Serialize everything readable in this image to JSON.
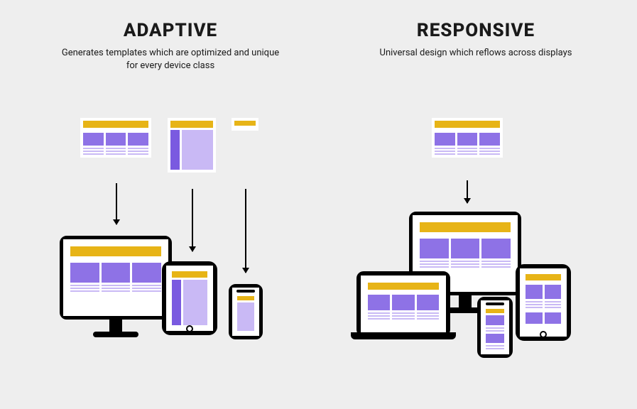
{
  "adaptive": {
    "title": "ADAPTIVE",
    "subtitle": "Generates templates which are optimized and unique for every device class"
  },
  "responsive": {
    "title": "RESPONSIVE",
    "subtitle": "Universal design which reflows across displays"
  },
  "colors": {
    "accent": "#e7b417",
    "primary": "#8e72e6",
    "light": "#c9b9f5",
    "bg": "#eeeeee"
  }
}
